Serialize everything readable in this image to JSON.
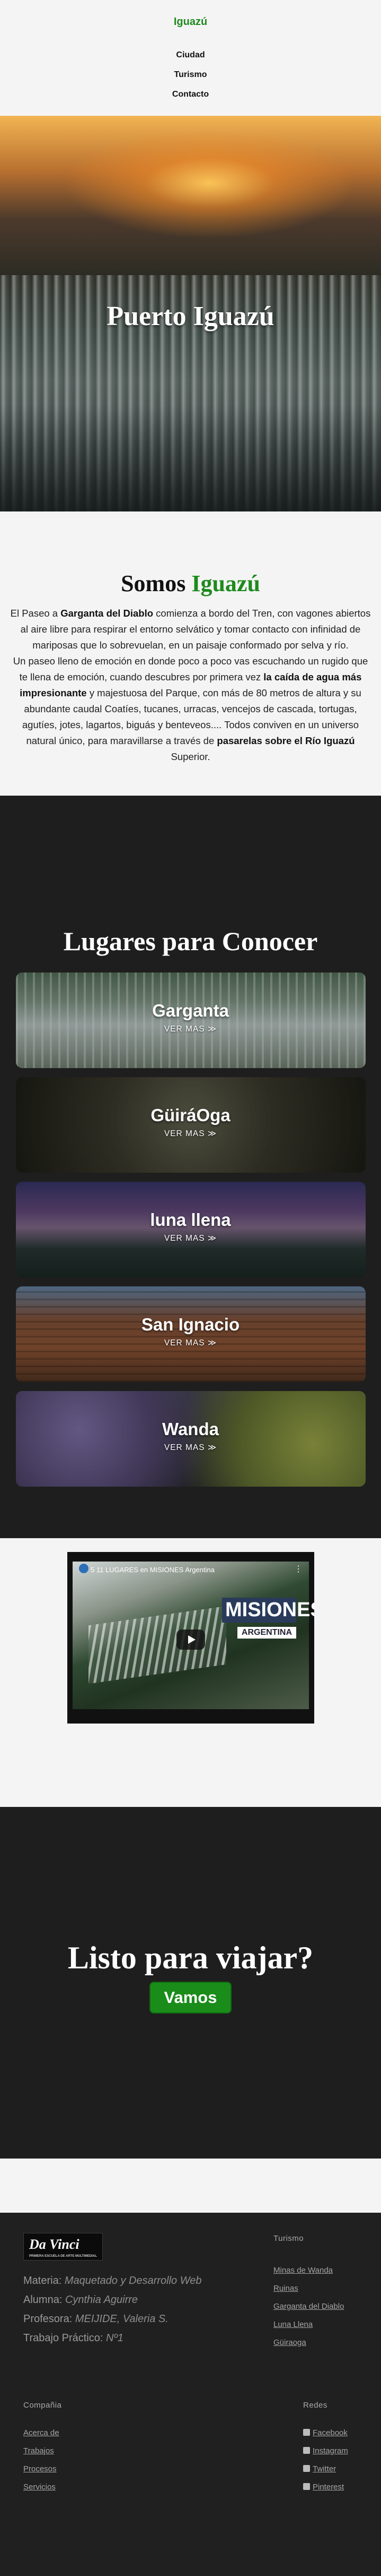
{
  "header": {
    "brand": "Iguazú",
    "nav": [
      "Ciudad",
      "Turismo",
      "Contacto"
    ]
  },
  "hero": {
    "title": "Puerto Iguazú"
  },
  "about": {
    "title_part1": "Somos",
    "title_part2": "Iguazú",
    "p1_a": "El Paseo a ",
    "p1_b": "Garganta del Diablo",
    "p1_c": " comienza a bordo del Tren, con vagones abiertos al aire libre para respirar el entorno selvático y tomar contacto con infinidad de mariposas que lo sobrevuelan, en un paisaje conformado por selva y río.",
    "p2_a": "Un paseo lleno de emoción en donde poco a poco vas escuchando un rugido que te llena de emoción, cuando descubres por primera vez ",
    "p2_b": "la caída de agua más impresionante",
    "p2_c": " y majestuosa del Parque, con más de 80 metros de altura y su abundante caudal Coatíes, tucanes, urracas, vencejos de cascada, tortugas, agutíes, jotes, lagartos, biguás y benteveos.... Todos conviven en un universo natural único, para maravillarse a través de ",
    "p2_d": "pasarelas sobre el Río Iguazú",
    "p2_e": " Superior."
  },
  "places": {
    "title": "Lugares para Conocer",
    "items": [
      {
        "title": "Garganta",
        "more": "VER MAS ≫"
      },
      {
        "title": "GüiráOga",
        "more": "VER MAS ≫"
      },
      {
        "title": "luna llena",
        "more": "VER MAS ≫"
      },
      {
        "title": "San Ignacio",
        "more": "VER MAS ≫"
      },
      {
        "title": "Wanda",
        "more": "VER MAS ≫"
      }
    ]
  },
  "video": {
    "title": "5 11 LUGARES en MISIONES Argentina",
    "menu": "⋮",
    "brand_big": "MISIONES",
    "brand_small": "ARGENTINA"
  },
  "cta": {
    "title": "Listo para viajar?",
    "button": "Vamos"
  },
  "footer": {
    "logo": "Da Vinci",
    "logo_sub": "PRIMERA ESCUELA DE ARTE MULTIMEDIAL",
    "info": [
      {
        "label": "Materia: ",
        "value": "Maquetado y Desarrollo Web"
      },
      {
        "label": "Alumna: ",
        "value": "Cynthia Aguirre"
      },
      {
        "label": "Profesora: ",
        "value": "MEIJIDE, Valeria S."
      },
      {
        "label": "Trabajo Práctico: ",
        "value": "Nº1"
      }
    ],
    "turismo_title": "Turismo",
    "turismo": [
      "Minas de Wanda",
      "Ruinas",
      "Garganta del Diablo",
      "Luna Llena",
      "Güiraoga"
    ],
    "compania_title": "Compañia",
    "compania": [
      "Acerca de",
      "Trabajos",
      "Procesos",
      "Servicios"
    ],
    "redes_title": "Redes",
    "redes": [
      {
        "label": "Facebook",
        "icon": "facebook-icon"
      },
      {
        "label": "Instagram",
        "icon": "instagram-icon"
      },
      {
        "label": "Twitter",
        "icon": "twitter-icon"
      },
      {
        "label": "Pinterest",
        "icon": "pinterest-icon"
      }
    ]
  }
}
